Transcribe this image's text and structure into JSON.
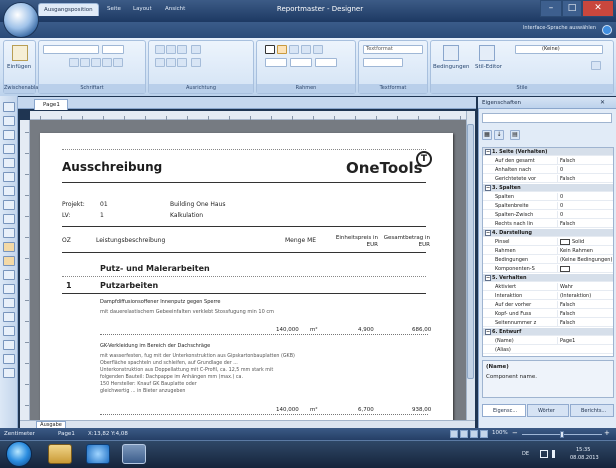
{
  "window": {
    "title": "Reportmaster - Designer"
  },
  "ribbon": {
    "tabs": [
      "Ausgangsposition",
      "Seite",
      "Layout",
      "Ansicht"
    ],
    "active_tab": "Ausgangsposition",
    "interface_language": "Interface-Sprache auswählen",
    "group_labels": [
      "Zwischenablage",
      "Schriftart",
      "Ausrichtung",
      "Rahmen",
      "Textformat",
      "Stile"
    ],
    "paste_label": "Einfügen",
    "textformat_value": "Textformat",
    "conditions_label": "Bedingungen",
    "style_label": "Stil-Editor",
    "style_combo_value": "(Keine)"
  },
  "doc_tabs": [
    "Page1"
  ],
  "sheet_tab": "Ausgabe",
  "page": {
    "title": "Ausschreibung",
    "brand": "OneTools",
    "project_label": "Projekt:",
    "project_no": "01",
    "project_name": "Building One Haus",
    "lv_label": "LV:",
    "lv_no": "1",
    "lv_name": "Kalkulation",
    "col_oz": "OZ",
    "col_desc": "Leistungsbeschreibung",
    "col_qty": "Menge ME",
    "col_unitprice": "Einheitspreis in EUR",
    "col_total": "Gesamtbetrag in EUR",
    "section_title": "Putz- und Malerarbeiten",
    "sub_no": "1",
    "sub_title": "Putzarbeiten",
    "item1_title": "Dampfdiffusionsoffener Innenputz gegen Sperre",
    "item1_text": "mit dauerelastischem Gebeeinfalten verklebt Stossfugung min 10 cm",
    "item1_qty": "140,000",
    "item1_unit": "m²",
    "item1_price": "4,900",
    "item1_total": "686,00",
    "item2_title": "GK-Verkleidung im Bereich der Dachschräge",
    "item2_lines": [
      "mit wasserfesten, fug mit der Unterkonstruktion aus Gipskartonbauplatten (GKB)",
      "Oberfläche spachteln und schleifen, auf Grundlage der ...",
      "Unterkonstruktion aus Doppellattung mit C-Profil, ca. 12,5 mm stark mit",
      "folgenden Bauteil: Dachpappe im Anhängen mm (max.)         ca.",
      "150 Hersteller: Knauf GK Bauplatte oder",
      "gleichwertig                                    ... in Bieter anzugeben"
    ],
    "item2_qty": "140,000",
    "item2_unit": "m²",
    "item2_price": "6,700",
    "item2_total": "938,00"
  },
  "properties": {
    "title": "Eigenschaften",
    "rows": [
      {
        "kind": "cat",
        "k": "1. Seite (Verhalten)"
      },
      {
        "k": "Auf den gesamt",
        "v": "Falsch"
      },
      {
        "k": "Anhalten nach",
        "v": "0"
      },
      {
        "k": "Gerichtetete vor",
        "v": "Falsch"
      },
      {
        "kind": "cat",
        "k": "3. Spalten"
      },
      {
        "k": "Spalten",
        "v": "0"
      },
      {
        "k": "Spaltenbreite",
        "v": "0"
      },
      {
        "k": "Spalten-Zwisch",
        "v": "0"
      },
      {
        "k": "Rechts nach lin",
        "v": "Falsch"
      },
      {
        "kind": "cat",
        "k": "4. Darstellung"
      },
      {
        "k": "Pinsel",
        "v": "Solid",
        "swatch": true
      },
      {
        "k": "Rahmen",
        "v": "Kein Rahmen"
      },
      {
        "k": "Bedingungen",
        "v": "(Keine Bedingungen)"
      },
      {
        "k": "Komponenten-S",
        "v": "",
        "swatch": true
      },
      {
        "kind": "cat",
        "k": "5. Verhalten"
      },
      {
        "k": "Aktiviert",
        "v": "Wahr"
      },
      {
        "k": "Interaktion",
        "v": "(Interaktion)"
      },
      {
        "k": "Auf der vorher",
        "v": "Falsch"
      },
      {
        "k": "Kopf- und Fuss",
        "v": "Falsch"
      },
      {
        "k": "Seitennummer z",
        "v": "Falsch"
      },
      {
        "kind": "cat",
        "k": "6. Entwurf"
      },
      {
        "k": "(Name)",
        "v": "Page1"
      },
      {
        "k": "(Alias)",
        "v": ""
      }
    ],
    "desc_title": "(Name)",
    "desc_text": "Component name.",
    "tabs": [
      "Eigensc...",
      "Wörter",
      "Berichts..."
    ]
  },
  "status": {
    "unit": "Zentimeter",
    "page": "Page1",
    "coords": "X:13,82  Y:4,08",
    "zoom": "100%"
  },
  "taskbar": {
    "time": "15:35",
    "date": "08.08.2013",
    "lang": "DE"
  }
}
